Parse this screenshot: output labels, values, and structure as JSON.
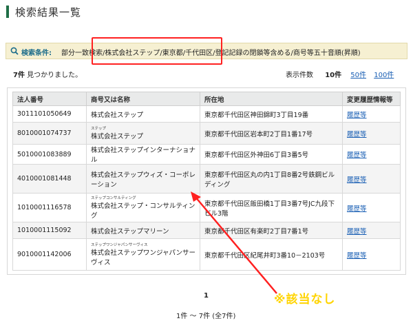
{
  "header": {
    "title": "検索結果一覧"
  },
  "conditions": {
    "label": "検索条件:",
    "text": "部分一致検索/株式会社ステップ/東京都/千代田区/登記記録の閉鎖等含める/商号等五十音順(昇順)"
  },
  "summary": {
    "found_count": "7件",
    "found_suffix": " 見つかりました。",
    "per_page_label": "表示件数",
    "per_page_current": "10件",
    "per_page_options": [
      "50件",
      "100件"
    ]
  },
  "table": {
    "headers": [
      "法人番号",
      "商号又は名称",
      "所在地",
      "変更履歴情報等"
    ],
    "rows": [
      {
        "number": "3011101050649",
        "furigana": "",
        "name": "株式会社ステップ",
        "address": "東京都千代田区神田錦町3丁目19番",
        "history": "履歴等"
      },
      {
        "number": "8010001074737",
        "furigana": "ステップ",
        "name": "株式会社ステップ",
        "address": "東京都千代田区岩本町2丁目1番17号",
        "history": "履歴等"
      },
      {
        "number": "5010001083889",
        "furigana": "",
        "name": "株式会社ステップインターナショナル",
        "address": "東京都千代田区外神田6丁目3番5号",
        "history": "履歴等"
      },
      {
        "number": "4010001081448",
        "furigana": "",
        "name": "株式会社ステップウィズ・コーポレーション",
        "address": "東京都千代田区丸の内1丁目8番2号鉄鋼ビルディング",
        "history": "履歴等"
      },
      {
        "number": "1010001116578",
        "furigana": "ステップコンサルティング",
        "name": "株式会社ステップ・コンサルティング",
        "address": "東京都千代田区飯田橋1丁目3番7号JC九段下ビル3階",
        "history": "履歴等"
      },
      {
        "number": "1010001115092",
        "furigana": "",
        "name": "株式会社ステップマリーン",
        "address": "東京都千代田区有楽町2丁目7番1号",
        "history": "履歴等"
      },
      {
        "number": "9010001142006",
        "furigana": "ステップワンジャパンサーヴィス",
        "name": "株式会社ステップワンジャパンサーヴィス",
        "address": "東京都千代田区紀尾井町3番10－2103号",
        "history": "履歴等"
      }
    ]
  },
  "annotation": {
    "text": "※該当なし",
    "color": "#ffd400",
    "arrow_color": "#ff2020"
  },
  "pagination": {
    "current_page": "1",
    "range_text": "1件 ～ 7件 (全7件)"
  },
  "colors": {
    "accent": "#1f6e46",
    "link": "#1a5fb4",
    "condition_bg": "#f6f0d2"
  }
}
